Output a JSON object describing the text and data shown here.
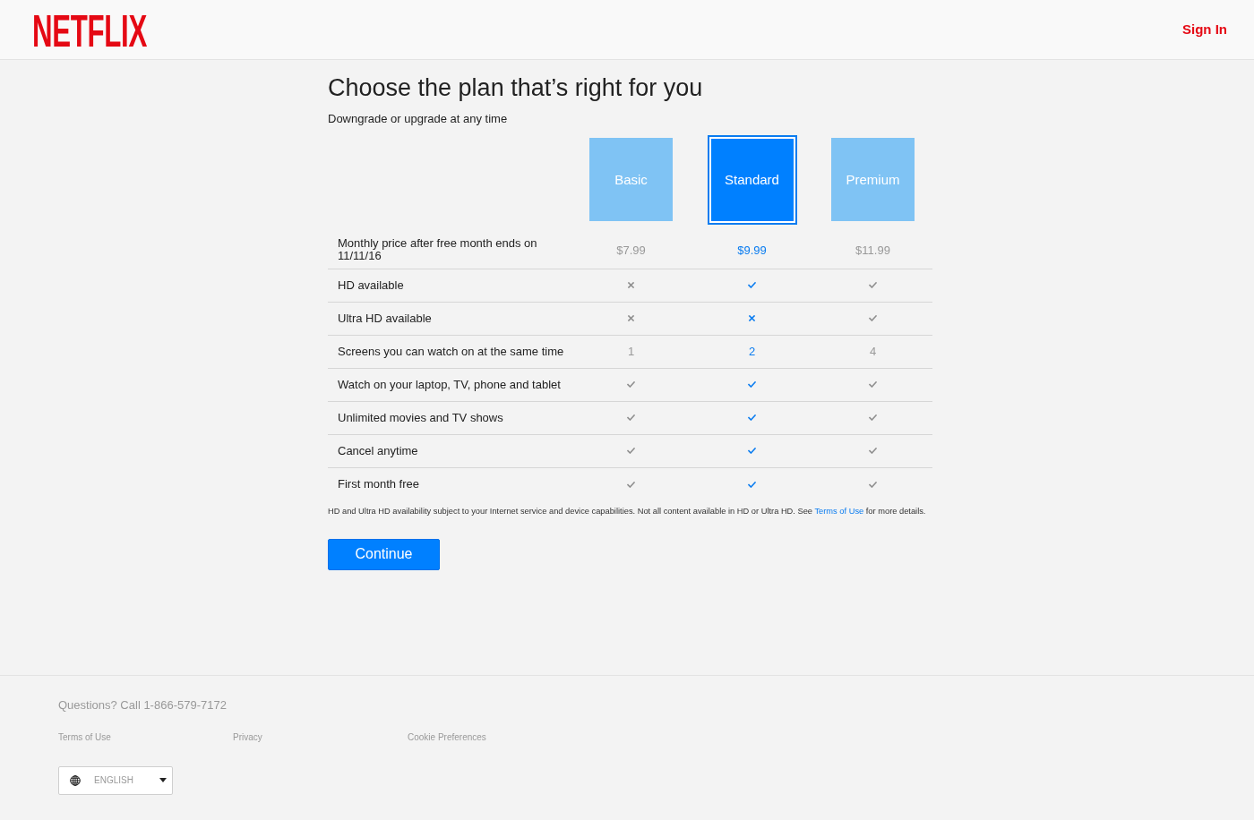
{
  "header": {
    "logo": "NETFLIX",
    "sign_in": "Sign In"
  },
  "title": "Choose the plan that’s right for you",
  "subtitle": "Downgrade or upgrade at any time",
  "plans": [
    {
      "name": "Basic",
      "selected": false
    },
    {
      "name": "Standard",
      "selected": true
    },
    {
      "name": "Premium",
      "selected": false
    }
  ],
  "features": [
    {
      "label": "Monthly price after free month ends on 11/11/16",
      "kind": "text",
      "cells": [
        {
          "text": "$7.99"
        },
        {
          "text": "$9.99"
        },
        {
          "text": "$11.99"
        }
      ]
    },
    {
      "label": "HD available",
      "kind": "check",
      "cells": [
        {
          "included": false
        },
        {
          "included": true
        },
        {
          "included": true
        }
      ]
    },
    {
      "label": "Ultra HD available",
      "kind": "check",
      "cells": [
        {
          "included": false
        },
        {
          "included": false
        },
        {
          "included": true
        }
      ]
    },
    {
      "label": "Screens you can watch on at the same time",
      "kind": "text",
      "cells": [
        {
          "text": "1"
        },
        {
          "text": "2"
        },
        {
          "text": "4"
        }
      ]
    },
    {
      "label": "Watch on your laptop, TV, phone and tablet",
      "kind": "check",
      "cells": [
        {
          "included": true
        },
        {
          "included": true
        },
        {
          "included": true
        }
      ]
    },
    {
      "label": "Unlimited movies and TV shows",
      "kind": "check",
      "cells": [
        {
          "included": true
        },
        {
          "included": true
        },
        {
          "included": true
        }
      ]
    },
    {
      "label": "Cancel anytime",
      "kind": "check",
      "cells": [
        {
          "included": true
        },
        {
          "included": true
        },
        {
          "included": true
        }
      ]
    },
    {
      "label": "First month free",
      "kind": "check",
      "cells": [
        {
          "included": true
        },
        {
          "included": true
        },
        {
          "included": true
        }
      ]
    }
  ],
  "footnote": {
    "before": "HD and Ultra HD availability subject to your Internet service and device capabilities. Not all content available in HD or Ultra HD. See",
    "link": "Terms of Use",
    "after": "for more details."
  },
  "continue_button": "Continue",
  "footer": {
    "phone": "Questions? Call 1-866-579-7172",
    "links": [
      "Terms of Use",
      "Privacy",
      "Cookie Preferences"
    ],
    "language": "ENGLISH"
  }
}
